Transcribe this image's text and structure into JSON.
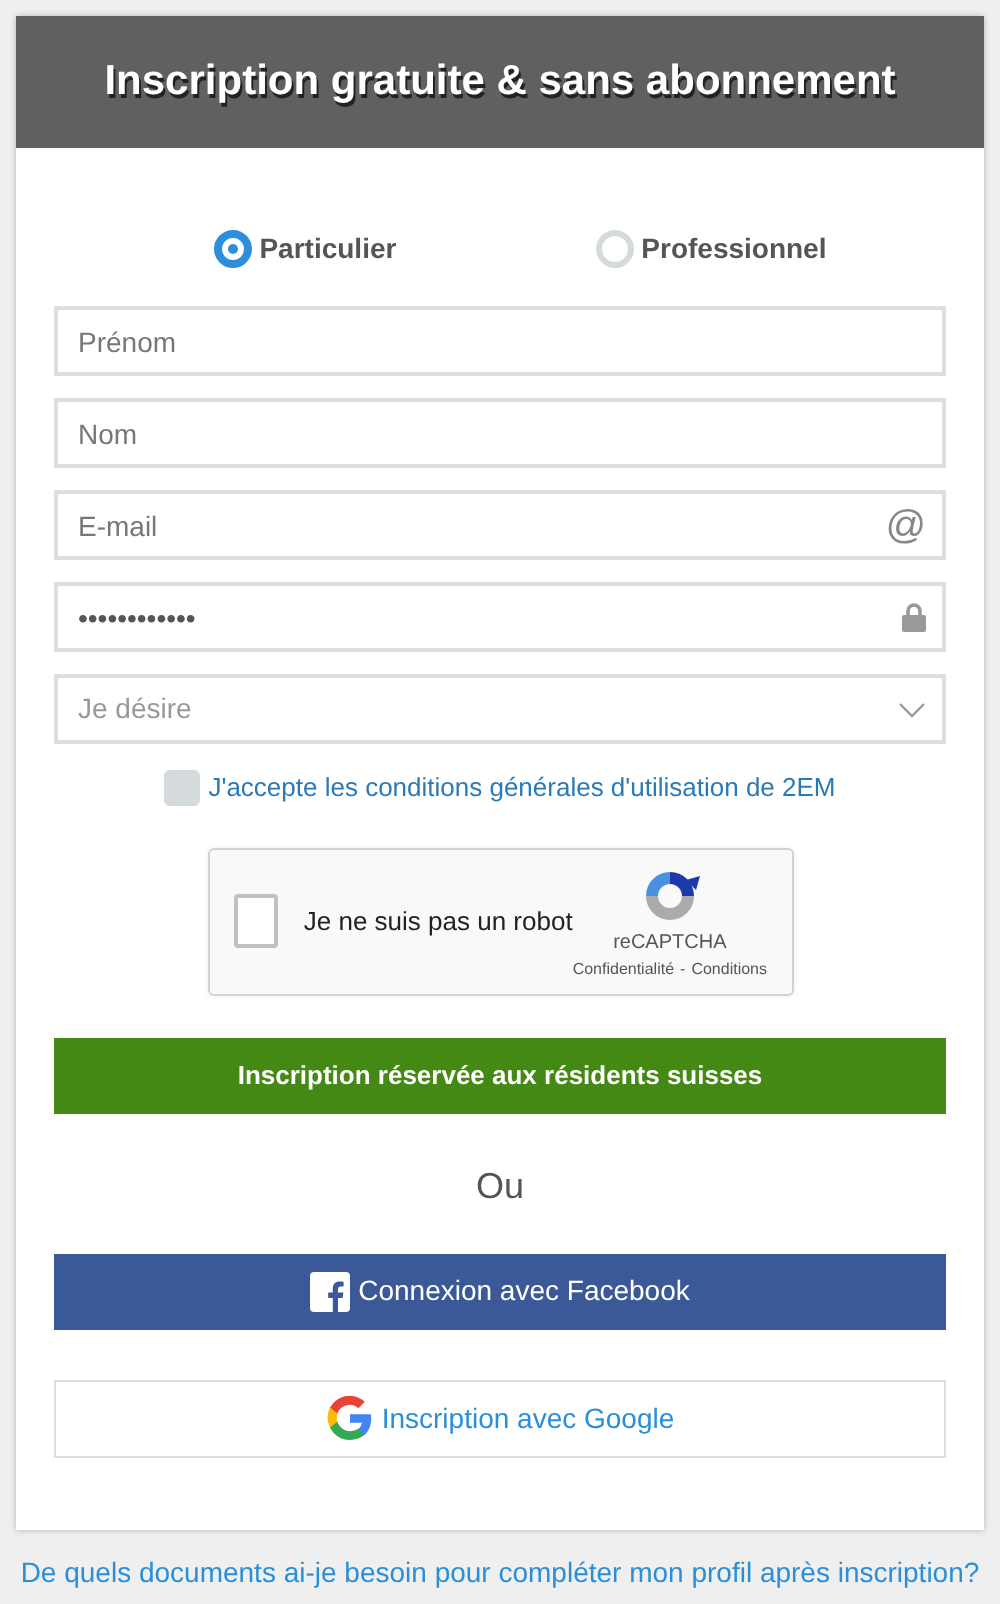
{
  "header": {
    "title": "Inscription gratuite & sans abonnement"
  },
  "account_types": [
    {
      "label": "Particulier",
      "selected": true
    },
    {
      "label": "Professionnel",
      "selected": false
    }
  ],
  "fields": [
    {
      "kind": "text",
      "placeholder": "Prénom"
    },
    {
      "kind": "text",
      "placeholder": "Nom"
    },
    {
      "kind": "email",
      "placeholder": "E-mail",
      "icon": "@"
    },
    {
      "kind": "password",
      "value": "••••••••••••"
    },
    {
      "kind": "select",
      "placeholder": "Je désire"
    }
  ],
  "terms": {
    "label": "J'accepte les conditions générales d'utilisation de 2EM",
    "checked": false
  },
  "captcha": {
    "label": "Je ne suis pas un robot",
    "checked": false,
    "brand": "reCAPTCHA",
    "privacy": "Confidentialité",
    "separator": "-",
    "terms": "Conditions"
  },
  "submit_button": "Inscription réservée aux résidents suisses",
  "separator": "Ou",
  "facebook_button": "Connexion avec Facebook",
  "google_button": "Inscription avec Google",
  "help_link": "De quels documents ai-je besoin pour compléter mon profil après inscription?"
}
